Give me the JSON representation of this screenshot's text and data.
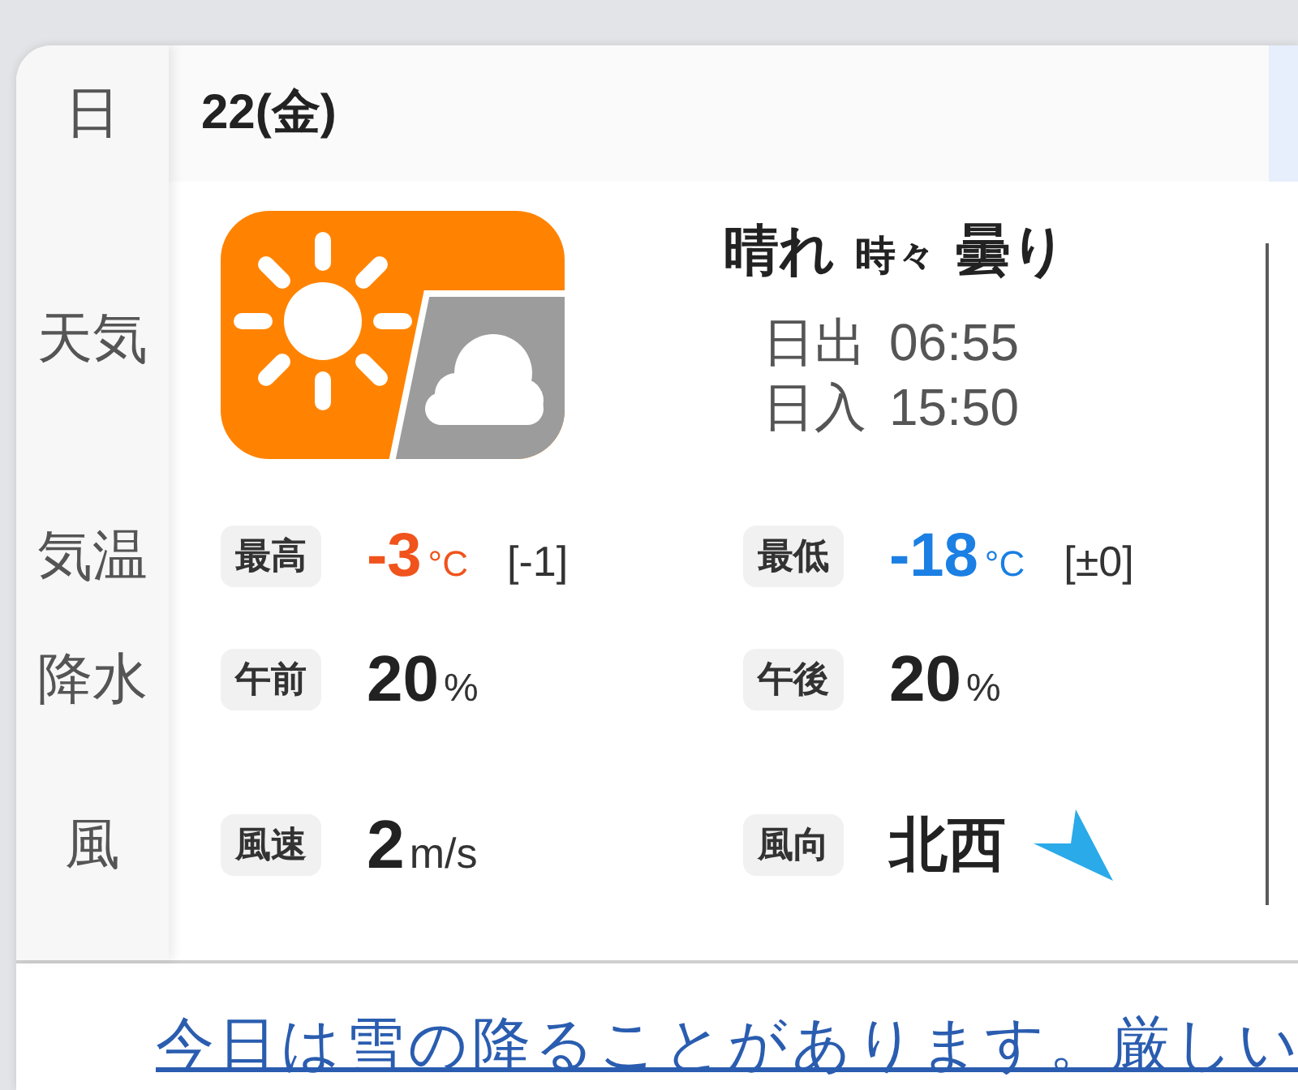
{
  "rows": [
    {
      "kind": "date",
      "label": "日",
      "date": "22(金)"
    },
    {
      "kind": "weather",
      "label": "天気",
      "condition": [
        {
          "text": "晴れ",
          "kind": "main"
        },
        {
          "text": "時々",
          "kind": "connector"
        },
        {
          "text": "曇り",
          "kind": "main"
        }
      ],
      "sun_times": [
        {
          "label": "日出",
          "time": "06:55"
        },
        {
          "label": "日入",
          "time": "15:50"
        }
      ]
    },
    {
      "kind": "temperature",
      "label": "気温",
      "items": [
        {
          "tag": "最高",
          "value": "-3",
          "unit": "°C",
          "change": "[-1]",
          "color": "#f0531c"
        },
        {
          "tag": "最低",
          "value": "-18",
          "unit": "°C",
          "change": "[±0]",
          "color": "#1b7fe3"
        }
      ]
    },
    {
      "kind": "precipitation",
      "label": "降水",
      "items": [
        {
          "tag": "午前",
          "value": "20",
          "unit": "%"
        },
        {
          "tag": "午後",
          "value": "20",
          "unit": "%"
        }
      ]
    },
    {
      "kind": "wind",
      "label": "風",
      "items": [
        {
          "kind": "speed",
          "tag": "風速",
          "value": "2",
          "unit": "m/s"
        },
        {
          "kind": "direction",
          "tag": "風向",
          "value": "北西"
        }
      ]
    }
  ],
  "notice_link": "今日は雪の降ることがあります。厳しい"
}
